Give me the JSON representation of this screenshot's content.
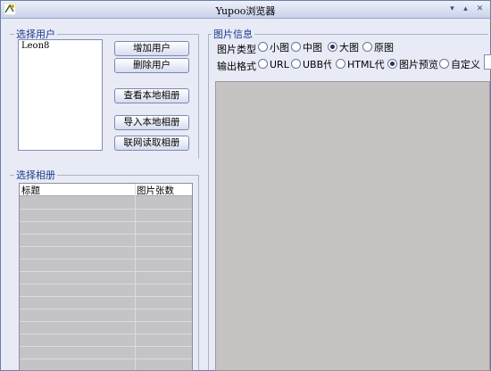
{
  "window": {
    "title": "Yupoo浏览器"
  },
  "titlebar_buttons": [
    "minimize",
    "restore",
    "close"
  ],
  "user_group": {
    "title": "选择用户",
    "users": [
      "Leon8"
    ],
    "buttons": {
      "add_user": "增加用户",
      "delete_user": "删除用户",
      "view_local_album": "查看本地相册",
      "import_local_album": "导入本地相册",
      "fetch_online_album": "联网读取相册"
    }
  },
  "album_group": {
    "title": "选择相册",
    "columns": [
      "标题",
      "图片张数"
    ],
    "rows": []
  },
  "image_info": {
    "title": "图片信息",
    "type_label": "图片类型",
    "type_options": [
      {
        "label": "小图",
        "selected": false
      },
      {
        "label": "中图",
        "selected": false
      },
      {
        "label": "大图",
        "selected": true
      },
      {
        "label": "原图",
        "selected": false
      }
    ],
    "format_label": "输出格式",
    "format_options": [
      {
        "label": "URL",
        "selected": false
      },
      {
        "label": "UBB代码",
        "selected": false
      },
      {
        "label": "HTML代码",
        "selected": false
      },
      {
        "label": "图片预览",
        "selected": true
      },
      {
        "label": "自定义",
        "selected": false
      }
    ]
  }
}
